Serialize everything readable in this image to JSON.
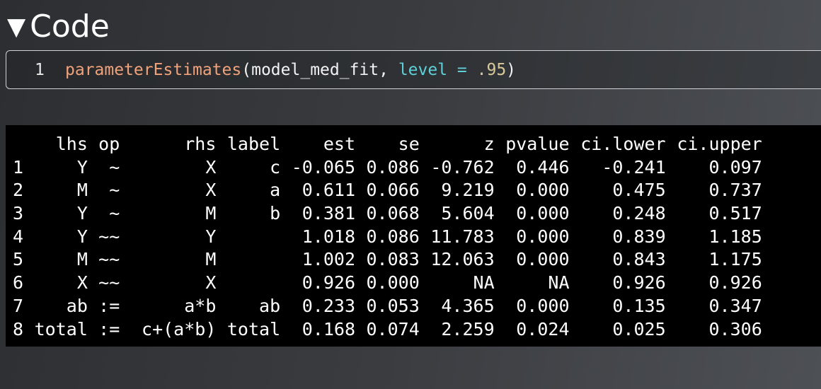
{
  "heading": {
    "toggle": "▼",
    "title": "Code"
  },
  "code": {
    "line_number": "1",
    "fn": "parameterEstimates",
    "open": "(",
    "arg1": "model_med_fit, ",
    "param": "level",
    "eq": " = ",
    "value": ".95",
    "close": ")"
  },
  "output": {
    "headers": [
      "",
      "lhs",
      "op",
      "rhs",
      "label",
      "est",
      "se",
      "z",
      "pvalue",
      "ci.lower",
      "ci.upper"
    ],
    "rows": [
      [
        "1",
        "Y",
        "~",
        "X",
        "c",
        "-0.065",
        "0.086",
        "-0.762",
        "0.446",
        "-0.241",
        "0.097"
      ],
      [
        "2",
        "M",
        "~",
        "X",
        "a",
        "0.611",
        "0.066",
        "9.219",
        "0.000",
        "0.475",
        "0.737"
      ],
      [
        "3",
        "Y",
        "~",
        "M",
        "b",
        "0.381",
        "0.068",
        "5.604",
        "0.000",
        "0.248",
        "0.517"
      ],
      [
        "4",
        "Y",
        "~~",
        "Y",
        "",
        "1.018",
        "0.086",
        "11.783",
        "0.000",
        "0.839",
        "1.185"
      ],
      [
        "5",
        "M",
        "~~",
        "M",
        "",
        "1.002",
        "0.083",
        "12.063",
        "0.000",
        "0.843",
        "1.175"
      ],
      [
        "6",
        "X",
        "~~",
        "X",
        "",
        "0.926",
        "0.000",
        "NA",
        "NA",
        "0.926",
        "0.926"
      ],
      [
        "7",
        "ab",
        ":=",
        "a*b",
        "ab",
        "0.233",
        "0.053",
        "4.365",
        "0.000",
        "0.135",
        "0.347"
      ],
      [
        "8",
        "total",
        ":=",
        "c+(a*b)",
        "total",
        "0.168",
        "0.074",
        "2.259",
        "0.024",
        "0.025",
        "0.306"
      ]
    ]
  }
}
